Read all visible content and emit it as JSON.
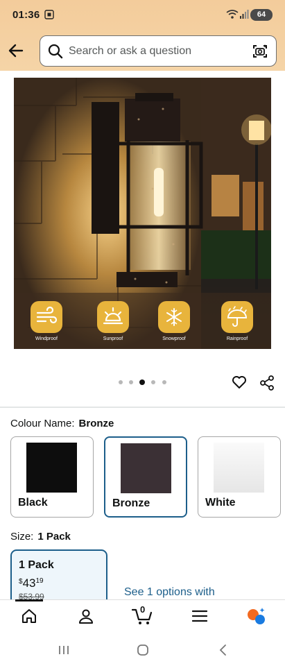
{
  "status_bar": {
    "time": "01:36",
    "battery": "64"
  },
  "search": {
    "placeholder": "Search or ask a question"
  },
  "product_image": {
    "features": [
      {
        "label": "Windproof",
        "icon": "wind-icon"
      },
      {
        "label": "Sunproof",
        "icon": "sun-icon"
      },
      {
        "label": "Snowproof",
        "icon": "snowflake-icon"
      },
      {
        "label": "Rainproof",
        "icon": "umbrella-icon"
      }
    ],
    "carousel": {
      "total": 5,
      "active_index": 2
    }
  },
  "colour": {
    "label": "Colour Name:",
    "selected": "Bronze",
    "options": [
      {
        "name": "Black",
        "color": "#111111"
      },
      {
        "name": "Bronze",
        "color": "#3b3035"
      },
      {
        "name": "White",
        "color": "#f2f2f2"
      }
    ]
  },
  "size": {
    "label": "Size:",
    "selected": "1 Pack",
    "option": {
      "name": "1 Pack",
      "currency": "$",
      "price_whole": "43",
      "price_fraction": "19",
      "list_price": "$53.99"
    },
    "see_options": "See 1 options with"
  },
  "tab_bar": {
    "cart_count": "0"
  },
  "colors": {
    "accent_blue": "#1c5e8a",
    "header_peach": "#f3cc9b",
    "badge_gold": "#e8b43c"
  }
}
